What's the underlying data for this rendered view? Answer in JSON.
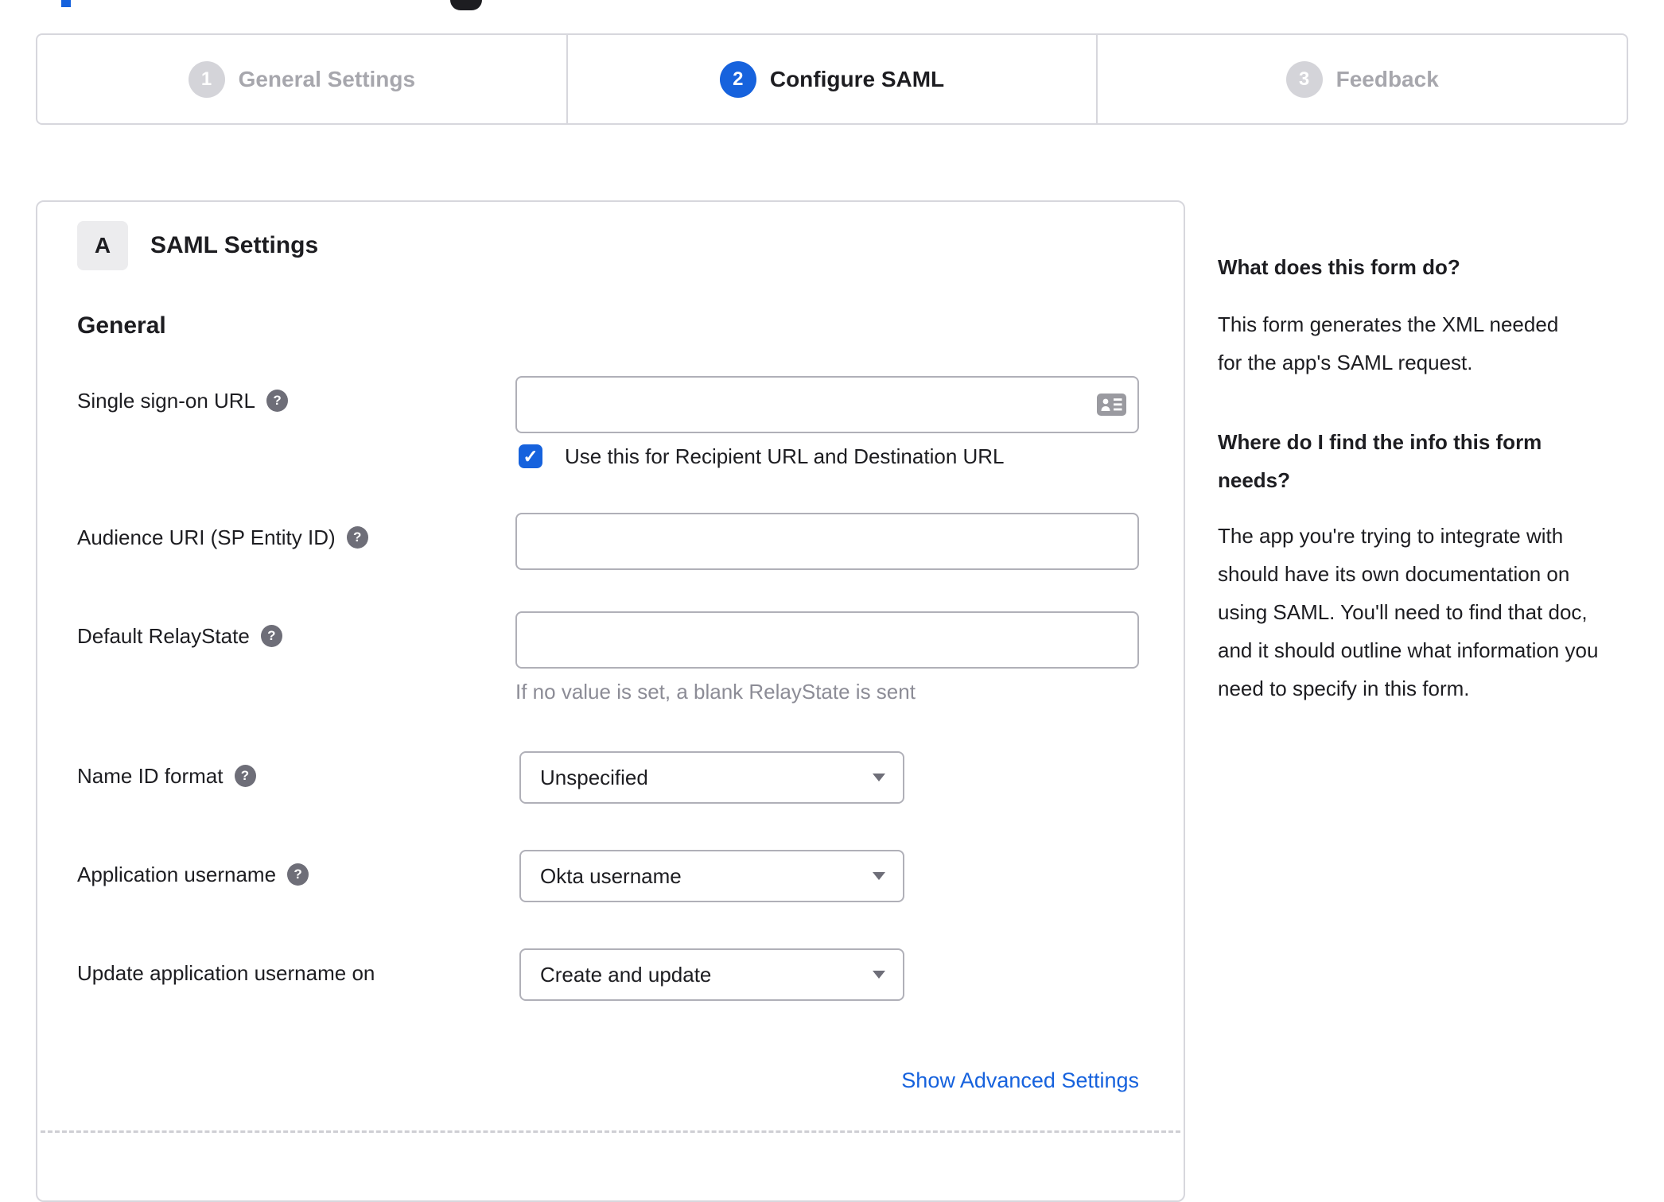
{
  "colors": {
    "accent_blue": "#1662dd",
    "panel_border": "#d7d7dd",
    "input_border": "#b0b0b8",
    "text_dark": "#1d1d21",
    "inactive_step_text": "#a7a7ad",
    "hint_gray": "#8c8c96",
    "help_icon_bg": "#6e6e78",
    "badge_bg": "#ececee"
  },
  "stepper": {
    "steps": [
      {
        "number": "1",
        "label": "General Settings",
        "state": "inactive"
      },
      {
        "number": "2",
        "label": "Configure SAML",
        "state": "active"
      },
      {
        "number": "3",
        "label": "Feedback",
        "state": "inactive"
      }
    ]
  },
  "panel": {
    "section_badge": "A",
    "section_title": "SAML Settings",
    "group_heading": "General",
    "fields": {
      "sso_url": {
        "label": "Single sign-on URL",
        "value": "",
        "checkbox": {
          "checked": true,
          "label": "Use this for Recipient URL and Destination URL"
        }
      },
      "audience_uri": {
        "label": "Audience URI (SP Entity ID)",
        "value": ""
      },
      "default_relaystate": {
        "label": "Default RelayState",
        "value": "",
        "hint": "If no value is set, a blank RelayState is sent"
      },
      "name_id_format": {
        "label": "Name ID format",
        "selected": "Unspecified"
      },
      "application_username": {
        "label": "Application username",
        "selected": "Okta username"
      },
      "update_application_username_on": {
        "label": "Update application username on",
        "selected": "Create and update"
      }
    },
    "advanced_link": "Show Advanced Settings"
  },
  "sidebar": {
    "sections": [
      {
        "heading": "What does this form do?",
        "body": "This form generates the XML needed for the app's SAML request."
      },
      {
        "heading": "Where do I find the info this form needs?",
        "body": "The app you're trying to integrate with should have its own documentation on using SAML. You'll need to find that doc, and it should outline what information you need to specify in this form."
      }
    ]
  },
  "icons": {
    "help_glyph": "?",
    "check_glyph": "✓",
    "sso_field_icon": "contact-card",
    "dropdown_caret": "caret-down"
  }
}
